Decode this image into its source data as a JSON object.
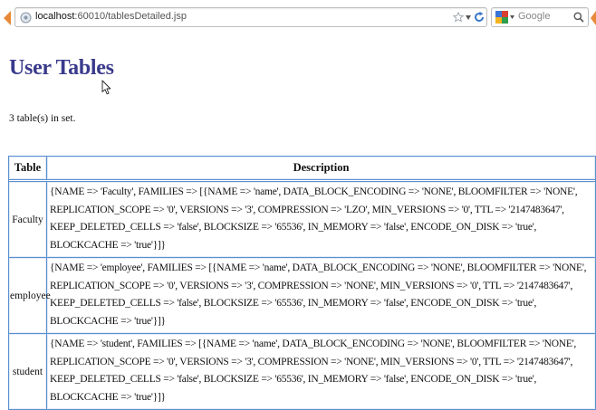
{
  "browser": {
    "url_host": "localhost",
    "url_path": ":60010/tablesDetailed.jsp",
    "search_placeholder": "Google"
  },
  "page": {
    "title": "User Tables",
    "count_text": "3 table(s) in set."
  },
  "table": {
    "headers": [
      "Table",
      "Description"
    ],
    "rows": [
      {
        "name": "Faculty",
        "description": "{NAME => 'Faculty', FAMILIES => [{NAME => 'name', DATA_BLOCK_ENCODING => 'NONE', BLOOMFILTER => 'NONE', REPLICATION_SCOPE => '0', VERSIONS => '3', COMPRESSION => 'LZO', MIN_VERSIONS => '0', TTL => '2147483647', KEEP_DELETED_CELLS => 'false', BLOCKSIZE => '65536', IN_MEMORY => 'false', ENCODE_ON_DISK => 'true', BLOCKCACHE => 'true'}]}"
      },
      {
        "name": "employee",
        "description": "{NAME => 'employee', FAMILIES => [{NAME => 'name', DATA_BLOCK_ENCODING => 'NONE', BLOOMFILTER => 'NONE', REPLICATION_SCOPE => '0', VERSIONS => '3', COMPRESSION => 'NONE', MIN_VERSIONS => '0', TTL => '2147483647', KEEP_DELETED_CELLS => 'false', BLOCKSIZE => '65536', IN_MEMORY => 'false', ENCODE_ON_DISK => 'true', BLOCKCACHE => 'true'}]}"
      },
      {
        "name": "student",
        "description": "{NAME => 'student', FAMILIES => [{NAME => 'name', DATA_BLOCK_ENCODING => 'NONE', BLOOMFILTER => 'NONE', REPLICATION_SCOPE => '0', VERSIONS => '3', COMPRESSION => 'NONE', MIN_VERSIONS => '0', TTL => '2147483647', KEEP_DELETED_CELLS => 'false', BLOCKSIZE => '65536', IN_MEMORY => 'false', ENCODE_ON_DISK => 'true', BLOCKCACHE => 'true'}]}"
      }
    ]
  },
  "icons": {
    "back": "back-arrow-icon",
    "site": "site-identity-icon",
    "bookmark": "bookmark-star-icon",
    "reload": "reload-icon",
    "search_engine": "google-logo-icon",
    "search": "magnifier-icon",
    "pointer": "mouse-cursor-icon"
  },
  "colors": {
    "title": "#3a3a8c",
    "table_border": "#5a8fd0",
    "back_button": "#e8893a"
  }
}
